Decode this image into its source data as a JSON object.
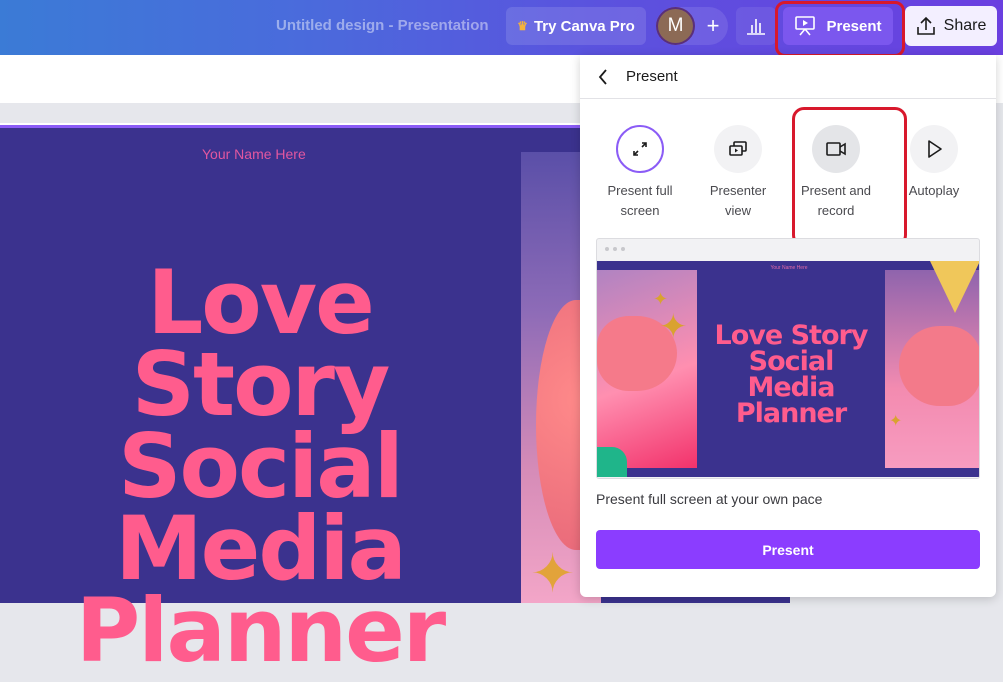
{
  "topbar": {
    "doc_title": "Untitled design - Presentation",
    "pro_button": "Try Canva Pro",
    "avatar_initial": "M",
    "add_label": "+",
    "present_label": "Present",
    "share_label": "Share"
  },
  "slide": {
    "name_text": "Your Name Here",
    "title_lines": [
      "Love Story",
      "Social",
      "Media",
      "Planner"
    ]
  },
  "present_panel": {
    "title": "Present",
    "options": [
      {
        "label_line1": "Present full",
        "label_line2": "screen",
        "icon": "expand-icon",
        "selected": true
      },
      {
        "label_line1": "Presenter",
        "label_line2": "view",
        "icon": "presenter-view-icon",
        "selected": false
      },
      {
        "label_line1": "Present and",
        "label_line2": "record",
        "icon": "video-camera-icon",
        "selected": false
      },
      {
        "label_line1": "Autoplay",
        "label_line2": "",
        "icon": "play-icon",
        "selected": false
      }
    ],
    "preview": {
      "name_text": "Your Name Here",
      "title_lines": [
        "Love Story",
        "Social",
        "Media",
        "Planner"
      ]
    },
    "description": "Present full screen at your own pace",
    "present_button": "Present"
  },
  "colors": {
    "accent_purple": "#8b3dff",
    "slide_bg": "#3b328e",
    "title_pink": "#ff5c8d",
    "highlight_red": "#d8182c"
  }
}
